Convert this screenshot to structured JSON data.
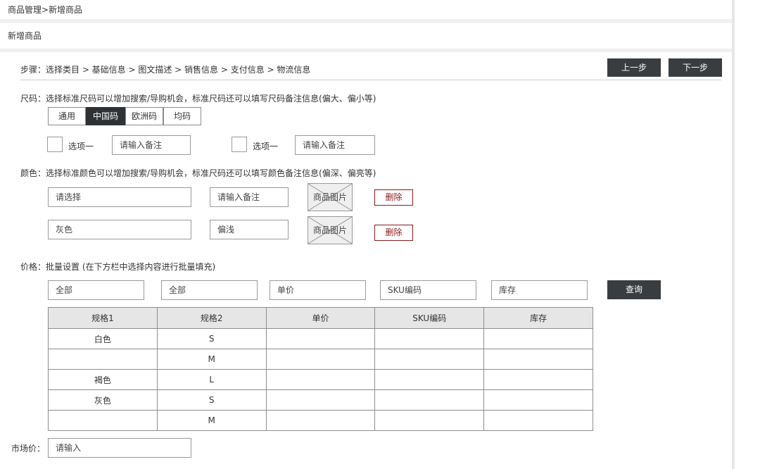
{
  "breadcrumb": "商品管理>新增商品",
  "page_title": "新增商品",
  "steps": {
    "text": "步骤：选择类目 > 基础信息 > 图文描述 > 销售信息 > 支付信息 > 物流信息",
    "prev_label": "上一步",
    "next_label": "下一步"
  },
  "size": {
    "title": "尺码：选择标准尺码可以增加搜索/导购机会，标准尺码还可以填写尺码备注信息(偏大、偏小等)",
    "tabs": [
      "通用",
      "中国码",
      "欧洲码",
      "均码"
    ],
    "active_tab": "中国码",
    "options": [
      {
        "label": "选项一",
        "note_placeholder": "请输入备注"
      },
      {
        "label": "选项一",
        "note_placeholder": "请输入备注"
      }
    ]
  },
  "color": {
    "title": "颜色：选择标准颜色可以增加搜索/导购机会，标准尺码还可以填写颜色备注信息(偏深、偏亮等)",
    "rows": [
      {
        "select": "请选择",
        "note": "请输入备注",
        "image": "商品图片",
        "delete": "删除"
      },
      {
        "select": "灰色",
        "note": "偏浅",
        "image": "商品图片",
        "delete": "删除"
      }
    ]
  },
  "price": {
    "title": "价格：批量设置 (在下方栏中选择内容进行批量填充)",
    "filters": [
      "全部",
      "全部",
      "单价",
      "SKU编码",
      "库存"
    ],
    "query_label": "查询",
    "table": {
      "headers": [
        "规格1",
        "规格2",
        "单价",
        "SKU编码",
        "库存"
      ],
      "rows": [
        [
          "白色",
          "S",
          "",
          "",
          ""
        ],
        [
          "",
          "M",
          "",
          "",
          ""
        ],
        [
          "褐色",
          "L",
          "",
          "",
          ""
        ],
        [
          "灰色",
          "S",
          "",
          "",
          ""
        ],
        [
          "",
          "M",
          "",
          "",
          ""
        ]
      ]
    }
  },
  "market_price": {
    "label": "市场价：",
    "placeholder": "请输入"
  }
}
